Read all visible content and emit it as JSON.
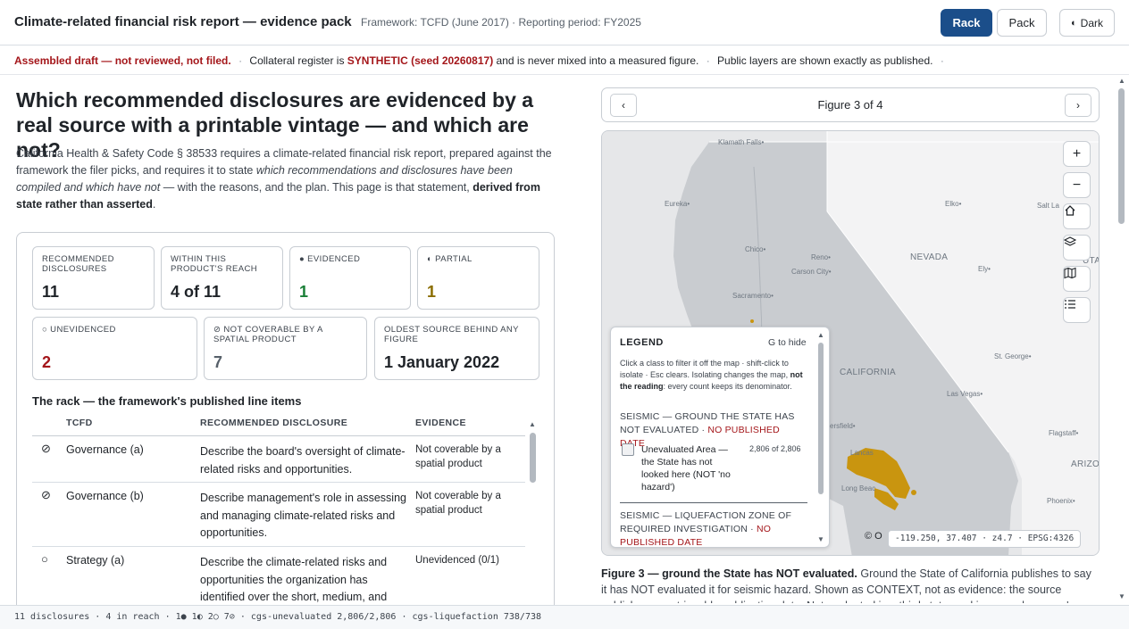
{
  "header": {
    "title": "Climate-related financial risk report — evidence pack",
    "meta": "Framework: TCFD (June 2017) · Reporting period: FY2025",
    "rack_label": "Rack",
    "pack_label": "Pack",
    "dark_label": "Dark",
    "dark_glyph": "◐"
  },
  "notice": {
    "draft": "Assembled draft — not reviewed, not filed.",
    "sep": "·",
    "collateral_pre": "Collateral register is",
    "synthetic": "SYNTHETIC (seed 20260817)",
    "collateral_post": "and is never mixed into a measured figure.",
    "layers": "Public layers are shown exactly as published."
  },
  "main": {
    "question": "Which recommended disclosures are evidenced by a real source with a printable vintage — and which are not?",
    "intro_1": "California Health & Safety Code § 38533 requires a climate-related financial risk report, prepared against the framework the filer picks, and requires it to state",
    "intro_em": "which recommendations and disclosures have been compiled and which have not",
    "intro_2": "— with the reasons, and the plan. This page is that statement,",
    "intro_strong": "derived from state rather than asserted",
    "intro_end": "."
  },
  "stats": [
    {
      "label": "Recommended disclosures",
      "value": "11"
    },
    {
      "label": "Within this product's reach",
      "value": "4 of 11"
    },
    {
      "label": "● Evidenced",
      "value": "1"
    },
    {
      "label": "◐ Partial",
      "value": "1"
    },
    {
      "label": "○ Unevidenced",
      "value": "2"
    },
    {
      "label": "⊘ Not coverable by a spatial product",
      "value": "7"
    },
    {
      "label": "Oldest source behind any figure",
      "value": "1 January 2022"
    }
  ],
  "rack": {
    "title": "The rack — the framework's published line items",
    "columns": [
      "TCFD",
      "Recommended disclosure",
      "Evidence"
    ],
    "rows": [
      {
        "icon": "⊘",
        "tcfd": "Governance (a)",
        "disclosure": "Describe the board's oversight of climate-related risks and opportunities.",
        "evidence": "Not coverable by a spatial product"
      },
      {
        "icon": "⊘",
        "tcfd": "Governance (b)",
        "disclosure": "Describe management's role in assessing and managing climate-related risks and opportunities.",
        "evidence": "Not coverable by a spatial product"
      },
      {
        "icon": "○",
        "tcfd": "Strategy (a)",
        "disclosure": "Describe the climate-related risks and opportunities the organization has identified over the short, medium, and long term.",
        "evidence": "Unevidenced (0/1)"
      }
    ]
  },
  "figure": {
    "counter": "Figure 3 of 4",
    "prev": "‹",
    "next": "›",
    "caption_label": "Figure 3 —",
    "caption_strong": "ground the State has NOT evaluated.",
    "caption_text": "Ground the State of California publishes to say it has NOT evaluated it for seismic hazard. Shown as CONTEXT, not as evidence: the source publishes no retrievable publication date. Not evaluated is a third state, and is never drawn as 'no hazard'."
  },
  "map": {
    "places": {
      "klamath": "Klamath Falls•",
      "eureka": "Eureka•",
      "elko": "Elko•",
      "saltlake": "Salt La",
      "chico": "Chico•",
      "reno": "Reno•",
      "carson": "Carson City•",
      "nevada": "NEVADA",
      "ely": "Ely•",
      "uta": "UTA",
      "sacramento": "Sacramento•",
      "california": "CALIFORNIA",
      "stgeorge": "St. George•",
      "lasvegas": "Las Vegas•",
      "flagstaff": "Flagstaff•",
      "arizo": "ARIZO",
      "phoenix": "Phoenix•",
      "bakersfield": "ersfield•",
      "lancaster": "Lancas",
      "longbeach": "Long Beac"
    },
    "controls": {
      "zoom_in": "+",
      "zoom_out": "−"
    },
    "attribution": "© O",
    "coords": "-119.250, 37.407 · z4.7 · EPSG:4326",
    "colors": {
      "unevaluated": "#c9950f",
      "state_fill": "#c9ccd0"
    }
  },
  "legend": {
    "title": "LEGEND",
    "hint": "G to hide",
    "help_1": "Click a class to filter it off the map · shift-click to isolate · Esc clears. Isolating changes the map,",
    "help_strong": "not the reading",
    "help_2": ": every count keeps its denominator.",
    "group1": "SEISMIC — GROUND THE STATE HAS NOT EVALUATED ·",
    "group1_np": "NO PUBLISHED DATE",
    "item_label": "Unevaluated Area — the State has not looked here (NOT 'no hazard')",
    "item_count": "2,806 of 2,806",
    "group2": "SEISMIC — LIQUEFACTION ZONE OF REQUIRED INVESTIGATION ·",
    "group2_np": "NO PUBLISHED DATE"
  },
  "footer": {
    "status": "11 disclosures · 4 in reach · 1● 1◐ 2○ 7⊘ · cgs-unevaluated 2,806/2,806 · cgs-liquefaction 738/738"
  }
}
